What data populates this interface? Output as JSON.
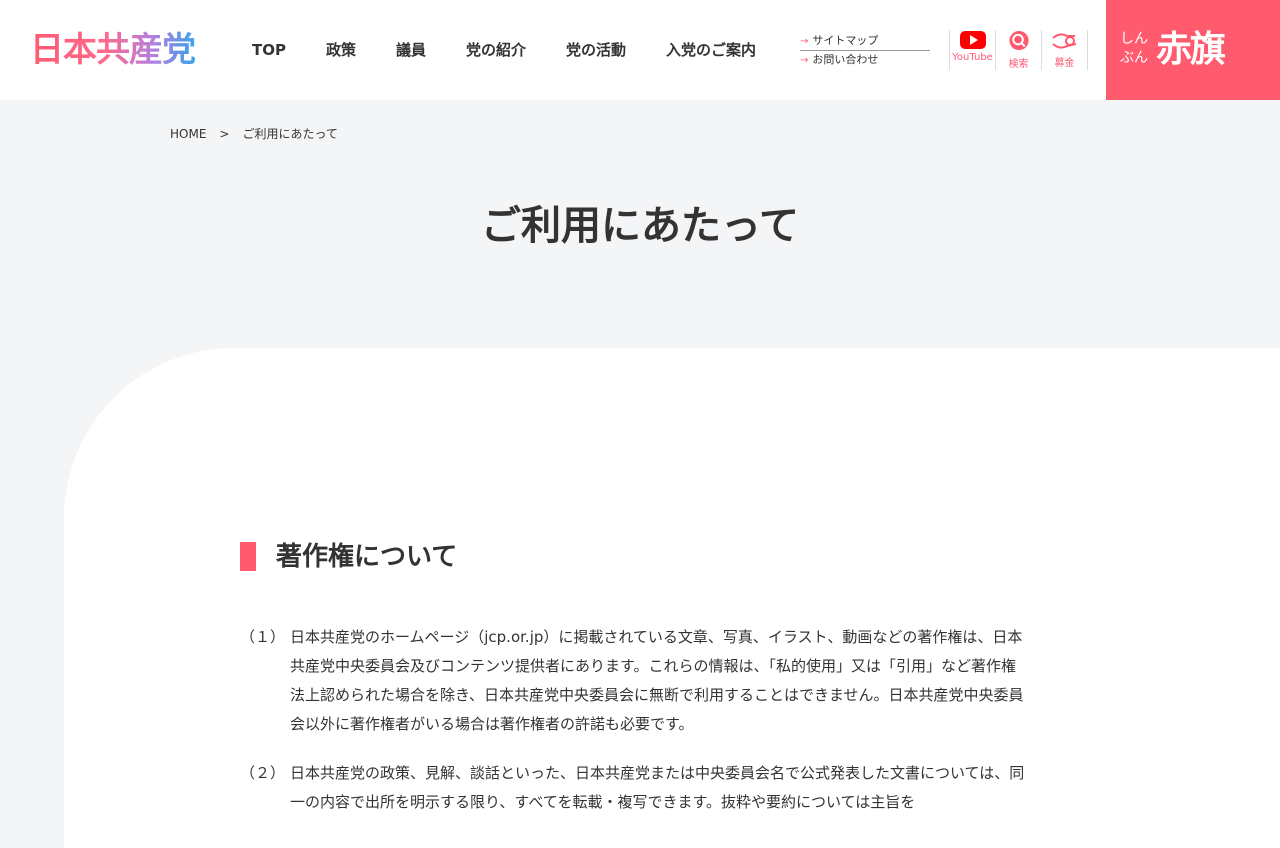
{
  "header": {
    "logo_text": "日本共産党",
    "nav": [
      "TOP",
      "政策",
      "議員",
      "党の紹介",
      "党の活動",
      "入党のご案内"
    ],
    "subnav": [
      "サイトマップ",
      "お問い合わせ"
    ],
    "icons": [
      {
        "label": "YouTube",
        "icon": "youtube-icon"
      },
      {
        "label": "検索",
        "icon": "search-icon"
      },
      {
        "label": "募金",
        "icon": "donation-icon"
      }
    ],
    "akahata": {
      "small": "しんぶん",
      "big": "赤旗",
      "icon": "arrow-right-icon"
    }
  },
  "breadcrumb": {
    "home": "HOME",
    "separator": ">",
    "current": "ご利用にあたって"
  },
  "page_title": "ご利用にあたって",
  "section": {
    "heading": "著作権について",
    "items": [
      {
        "num": "（１）",
        "text": "日本共産党のホームページ（jcp.or.jp）に掲載されている文章、写真、イラスト、動画などの著作権は、日本共産党中央委員会及びコンテンツ提供者にあります。これらの情報は、「私的使用」又は「引用」など著作権法上認められた場合を除き、日本共産党中央委員会に無断で利用することはできません。日本共産党中央委員会以外に著作権者がいる場合は著作権者の許諾も必要です。"
      },
      {
        "num": "（２）",
        "text": "日本共産党の政策、見解、談話といった、日本共産党または中央委員会名で公式発表した文書については、同一の内容で出所を明示する限り、すべてを転載・複写できます。抜粋や要約については主旨を"
      }
    ]
  },
  "colors": {
    "accent": "#ff5a6e",
    "background": "#f4f5f7",
    "text": "#333333"
  }
}
